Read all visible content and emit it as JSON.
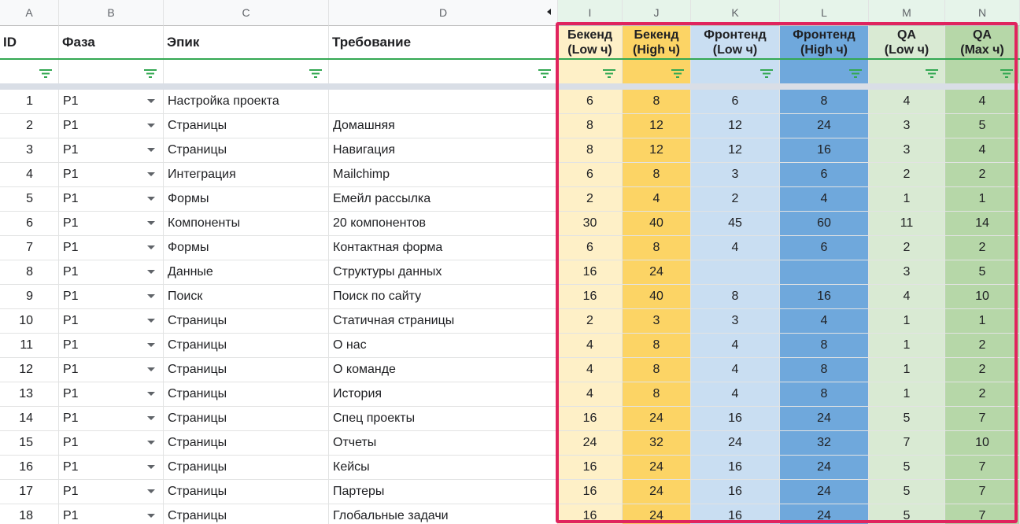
{
  "columns": [
    "A",
    "B",
    "C",
    "D",
    "I",
    "J",
    "K",
    "L",
    "M",
    "N"
  ],
  "headers": {
    "id": "ID",
    "phase": "Фаза",
    "epic": "Эпик",
    "req": "Требование",
    "be_low": [
      "Бекенд",
      "(Low ч)"
    ],
    "be_high": [
      "Бекенд",
      "(High ч)"
    ],
    "fe_low": [
      "Фронтенд",
      "(Low ч)"
    ],
    "fe_high": [
      "Фронтенд",
      "(High ч)"
    ],
    "qa_low": [
      "QA",
      "(Low ч)"
    ],
    "qa_max": [
      "QA",
      "(Max ч)"
    ]
  },
  "icons": {
    "filter": "filter-icon",
    "dropdown": "chevron-down-icon",
    "hidden_cols": "hidden-columns-arrows"
  },
  "colors": {
    "highlight_border": "#e0245e",
    "header_line": "#34a853"
  },
  "rows": [
    {
      "id": "1",
      "phase": "P1",
      "epic": "Настройка проекта",
      "req": "",
      "v": [
        "6",
        "8",
        "6",
        "8",
        "4",
        "4"
      ]
    },
    {
      "id": "2",
      "phase": "P1",
      "epic": "Страницы",
      "req": "Домашняя",
      "v": [
        "8",
        "12",
        "12",
        "24",
        "3",
        "5"
      ]
    },
    {
      "id": "3",
      "phase": "P1",
      "epic": "Страницы",
      "req": "Навигация",
      "v": [
        "8",
        "12",
        "12",
        "16",
        "3",
        "4"
      ]
    },
    {
      "id": "4",
      "phase": "P1",
      "epic": "Интеграция",
      "req": "Mailchimp",
      "v": [
        "6",
        "8",
        "3",
        "6",
        "2",
        "2"
      ]
    },
    {
      "id": "5",
      "phase": "P1",
      "epic": "Формы",
      "req": "Емейл рассылка",
      "v": [
        "2",
        "4",
        "2",
        "4",
        "1",
        "1"
      ]
    },
    {
      "id": "6",
      "phase": "P1",
      "epic": "Компоненты",
      "req": "20 компонентов",
      "v": [
        "30",
        "40",
        "45",
        "60",
        "11",
        "14"
      ]
    },
    {
      "id": "7",
      "phase": "P1",
      "epic": "Формы",
      "req": "Контактная форма",
      "v": [
        "6",
        "8",
        "4",
        "6",
        "2",
        "2"
      ]
    },
    {
      "id": "8",
      "phase": "P1",
      "epic": "Данные",
      "req": "Структуры данных",
      "v": [
        "16",
        "24",
        "",
        "",
        "3",
        "5"
      ]
    },
    {
      "id": "9",
      "phase": "P1",
      "epic": "Поиск",
      "req": "Поиск по сайту",
      "v": [
        "16",
        "40",
        "8",
        "16",
        "4",
        "10"
      ]
    },
    {
      "id": "10",
      "phase": "P1",
      "epic": "Страницы",
      "req": "Статичная страницы",
      "v": [
        "2",
        "3",
        "3",
        "4",
        "1",
        "1"
      ]
    },
    {
      "id": "11",
      "phase": "P1",
      "epic": "Страницы",
      "req": "О нас",
      "v": [
        "4",
        "8",
        "4",
        "8",
        "1",
        "2"
      ]
    },
    {
      "id": "12",
      "phase": "P1",
      "epic": "Страницы",
      "req": "О команде",
      "v": [
        "4",
        "8",
        "4",
        "8",
        "1",
        "2"
      ]
    },
    {
      "id": "13",
      "phase": "P1",
      "epic": "Страницы",
      "req": "История",
      "v": [
        "4",
        "8",
        "4",
        "8",
        "1",
        "2"
      ]
    },
    {
      "id": "14",
      "phase": "P1",
      "epic": "Страницы",
      "req": "Спец проекты",
      "v": [
        "16",
        "24",
        "16",
        "24",
        "5",
        "7"
      ]
    },
    {
      "id": "15",
      "phase": "P1",
      "epic": "Страницы",
      "req": "Отчеты",
      "v": [
        "24",
        "32",
        "24",
        "32",
        "7",
        "10"
      ]
    },
    {
      "id": "16",
      "phase": "P1",
      "epic": "Страницы",
      "req": "Кейсы",
      "v": [
        "16",
        "24",
        "16",
        "24",
        "5",
        "7"
      ]
    },
    {
      "id": "17",
      "phase": "P1",
      "epic": "Страницы",
      "req": "Партеры",
      "v": [
        "16",
        "24",
        "16",
        "24",
        "5",
        "7"
      ]
    },
    {
      "id": "18",
      "phase": "P1",
      "epic": "Страницы",
      "req": "Глобальные задачи",
      "v": [
        "16",
        "24",
        "16",
        "24",
        "5",
        "7"
      ]
    }
  ]
}
